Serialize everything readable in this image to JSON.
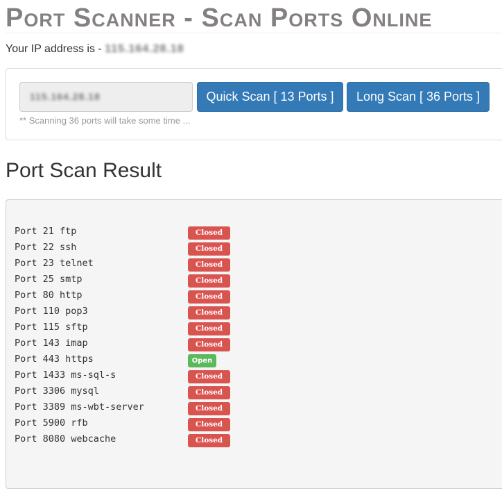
{
  "header": {
    "title": "Port Scanner - Scan Ports Online",
    "ip_label": "Your IP address is - ",
    "ip_value": "115.164.28.18"
  },
  "scan_form": {
    "ip_input_value": "115.164.28.18",
    "quick_scan_label": "Quick Scan [ 13 Ports ]",
    "long_scan_label": "Long Scan [ 36 Ports ]",
    "note": "** Scanning 36 ports will take some time ..."
  },
  "results": {
    "title": "Port Scan Result",
    "ports": [
      {
        "label": "Port 21 ftp",
        "status": "Closed"
      },
      {
        "label": "Port 22 ssh",
        "status": "Closed"
      },
      {
        "label": "Port 23 telnet",
        "status": "Closed"
      },
      {
        "label": "Port 25 smtp",
        "status": "Closed"
      },
      {
        "label": "Port 80 http",
        "status": "Closed"
      },
      {
        "label": "Port 110 pop3",
        "status": "Closed"
      },
      {
        "label": "Port 115 sftp",
        "status": "Closed"
      },
      {
        "label": "Port 143 imap",
        "status": "Closed"
      },
      {
        "label": "Port 443 https",
        "status": "Open"
      },
      {
        "label": "Port 1433 ms-sql-s",
        "status": "Closed"
      },
      {
        "label": "Port 3306 mysql",
        "status": "Closed"
      },
      {
        "label": "Port 3389 ms-wbt-server",
        "status": "Closed"
      },
      {
        "label": "Port 5900 rfb",
        "status": "Closed"
      },
      {
        "label": "Port 8080 webcache",
        "status": "Closed"
      }
    ]
  },
  "colors": {
    "title": "#858080",
    "button": "#337ab7",
    "closed": "#d9534f",
    "open": "#5cb85c",
    "result_bg": "#f5f5f5"
  }
}
